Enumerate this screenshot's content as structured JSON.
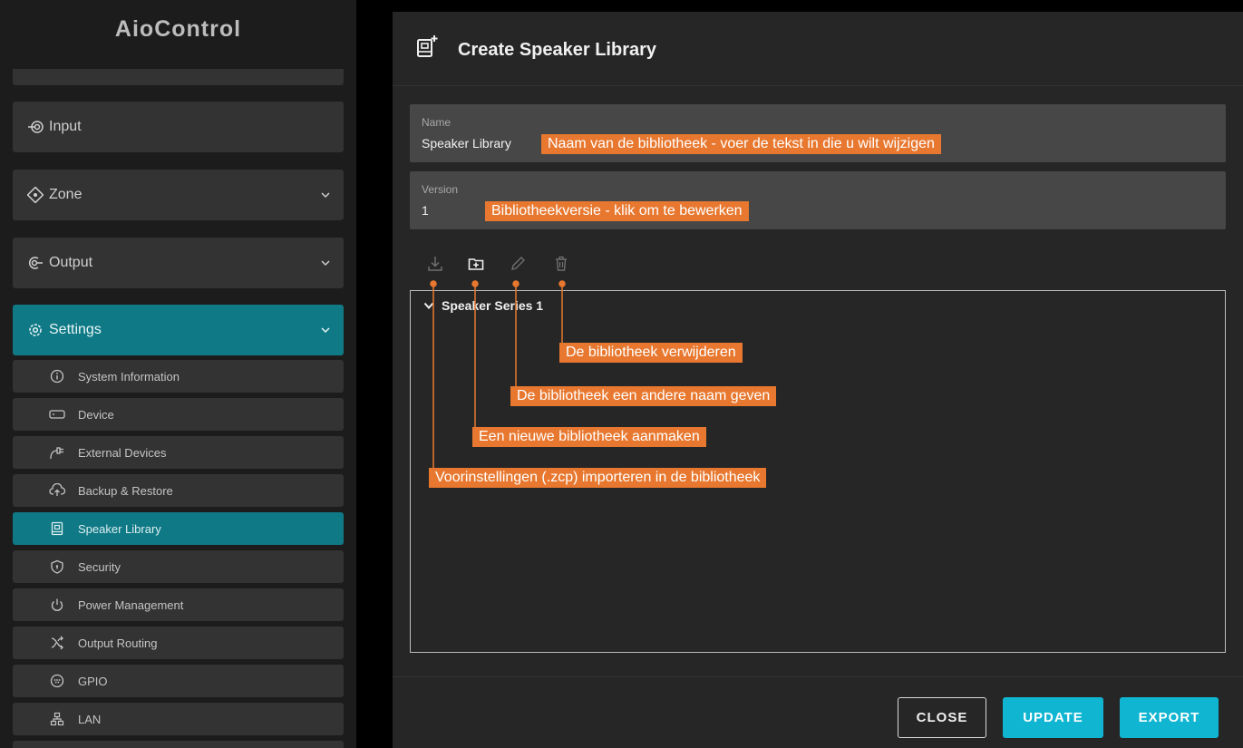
{
  "app": {
    "title": "AioControl"
  },
  "sidebar": {
    "nav": [
      {
        "label": "Input",
        "icon": "input-icon"
      },
      {
        "label": "Zone",
        "icon": "zone-icon"
      },
      {
        "label": "Output",
        "icon": "output-icon"
      },
      {
        "label": "Settings",
        "icon": "gear-icon"
      }
    ],
    "settings_items": [
      {
        "label": "System Information",
        "icon": "info-icon"
      },
      {
        "label": "Device",
        "icon": "device-icon"
      },
      {
        "label": "External Devices",
        "icon": "plug-icon"
      },
      {
        "label": "Backup & Restore",
        "icon": "cloud-upload-icon"
      },
      {
        "label": "Speaker Library",
        "icon": "book-icon"
      },
      {
        "label": "Security",
        "icon": "shield-icon"
      },
      {
        "label": "Power Management",
        "icon": "power-icon"
      },
      {
        "label": "Output Routing",
        "icon": "shuffle-icon"
      },
      {
        "label": "GPIO",
        "icon": "gpio-icon"
      },
      {
        "label": "LAN",
        "icon": "network-icon"
      }
    ]
  },
  "dialog": {
    "title": "Create Speaker Library",
    "name_field": {
      "label": "Name",
      "value": "Speaker Library"
    },
    "version_field": {
      "label": "Version",
      "value": "1"
    },
    "tree": {
      "item": "Speaker Series 1"
    },
    "buttons": {
      "close": "CLOSE",
      "update": "UPDATE",
      "export": "EXPORT"
    }
  },
  "annotations": {
    "name": "Naam van de bibliotheek - voer de tekst in die u wilt wijzigen",
    "version": "Bibliotheekversie - klik om te bewerken",
    "delete": "De bibliotheek verwijderen",
    "rename": "De bibliotheek een andere naam geven",
    "new": "Een nieuwe bibliotheek aanmaken",
    "import": "Voorinstellingen (.zcp) importeren in de bibliotheek"
  },
  "colors": {
    "accent": "#0f7a86",
    "button": "#10b5d2",
    "annotation": "#e8782f"
  }
}
